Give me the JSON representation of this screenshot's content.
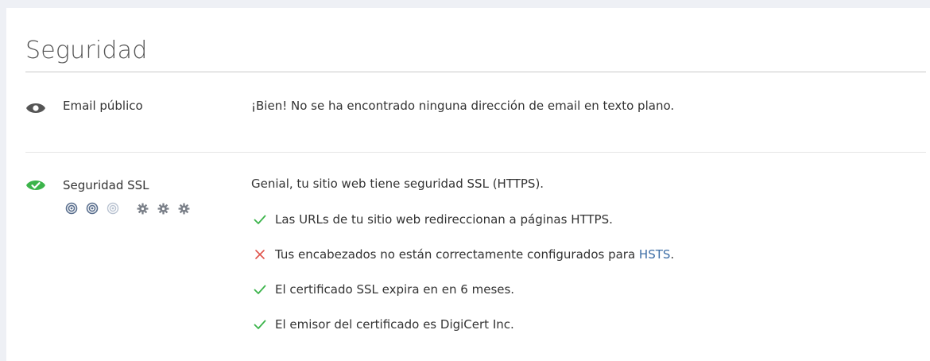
{
  "section": {
    "title": "Seguridad"
  },
  "email_row": {
    "icon": "eye-icon",
    "icon_color": "#555555",
    "label": "Email público",
    "description": "¡Bien! No se ha encontrado ninguna dirección de email en texto plano."
  },
  "ssl_row": {
    "icon": "check-circle-icon",
    "icon_color": "#3cb44b",
    "label": "Seguridad SSL",
    "rating": {
      "targets_filled": 2,
      "targets_total": 3,
      "gears_total": 3
    },
    "description": "Genial, tu sitio web tiene seguridad SSL (HTTPS).",
    "checks": [
      {
        "status": "ok",
        "icon": "check-icon",
        "text": "Las URLs de tu sitio web redireccionan a páginas HTTPS."
      },
      {
        "status": "fail",
        "icon": "x-icon",
        "text": "Tus encabezados no están correctamente configurados para HSTS.",
        "link_word": "HSTS"
      },
      {
        "status": "ok",
        "icon": "check-icon",
        "text": "El certificado SSL expira en en 6 meses."
      },
      {
        "status": "ok",
        "icon": "check-icon",
        "text": "El emisor del certificado es DigiCert Inc."
      }
    ],
    "colors": {
      "ok": "#3cb44b",
      "fail": "#e0544c",
      "link": "#3d6ea6"
    }
  }
}
